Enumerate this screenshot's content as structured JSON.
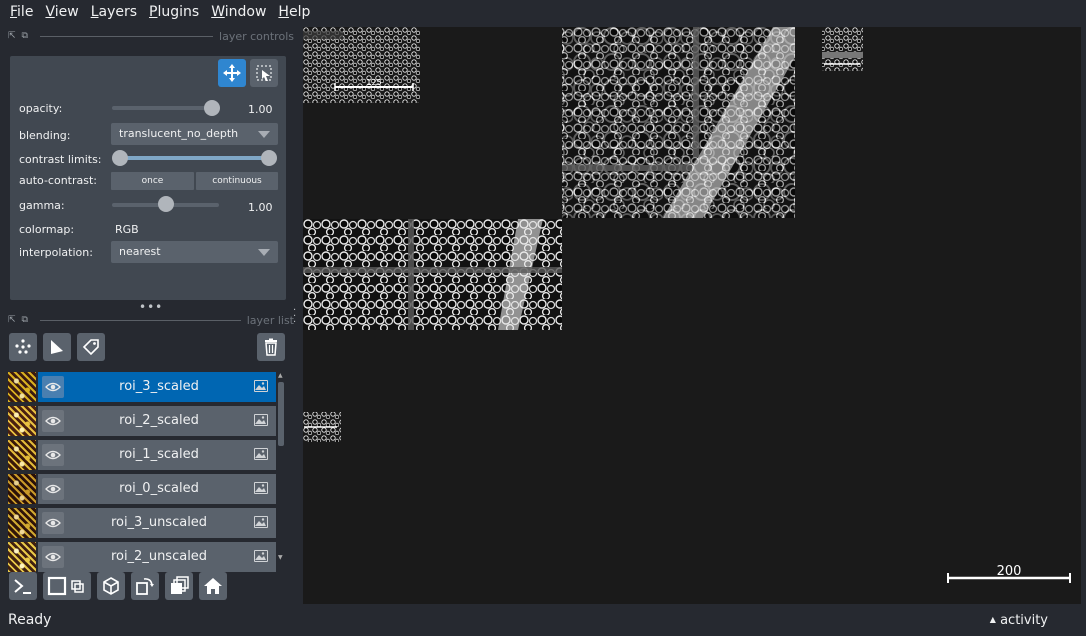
{
  "menu": [
    {
      "label": "File",
      "mnemonic": "F",
      "rest": "ile"
    },
    {
      "label": "View",
      "mnemonic": "V",
      "rest": "iew"
    },
    {
      "label": "Layers",
      "mnemonic": "L",
      "rest": "ayers"
    },
    {
      "label": "Plugins",
      "mnemonic": "P",
      "rest": "lugins"
    },
    {
      "label": "Window",
      "mnemonic": "W",
      "rest": "indow"
    },
    {
      "label": "Help",
      "mnemonic": "H",
      "rest": "elp"
    }
  ],
  "layer_controls": {
    "title": "layer controls",
    "opacity_label": "opacity:",
    "opacity_value": "1.00",
    "opacity_fraction": 1.0,
    "blending_label": "blending:",
    "blending_value": "translucent_no_depth",
    "contrast_label": "contrast limits:",
    "contrast_range": [
      0.0,
      1.0
    ],
    "auto_contrast_label": "auto-contrast:",
    "once_label": "once",
    "continuous_label": "continuous",
    "gamma_label": "gamma:",
    "gamma_value": "1.00",
    "gamma_fraction": 0.5,
    "colormap_label": "colormap:",
    "colormap_value": "RGB",
    "interpolation_label": "interpolation:",
    "interpolation_value": "nearest"
  },
  "layer_list": {
    "title": "layer list",
    "layers": [
      {
        "name": "roi_3_scaled",
        "selected": true
      },
      {
        "name": "roi_2_scaled",
        "selected": false
      },
      {
        "name": "roi_1_scaled",
        "selected": false
      },
      {
        "name": "roi_0_scaled",
        "selected": false
      },
      {
        "name": "roi_3_unscaled",
        "selected": false
      },
      {
        "name": "roi_2_unscaled",
        "selected": false
      }
    ]
  },
  "canvas": {
    "scale_bar_label": "200",
    "inset_scale_label": "125"
  },
  "status": {
    "text": "Ready",
    "activity_label": "activity"
  },
  "colors": {
    "accent": "#0066b2",
    "panel_bg": "#414851",
    "app_bg": "#262930"
  }
}
